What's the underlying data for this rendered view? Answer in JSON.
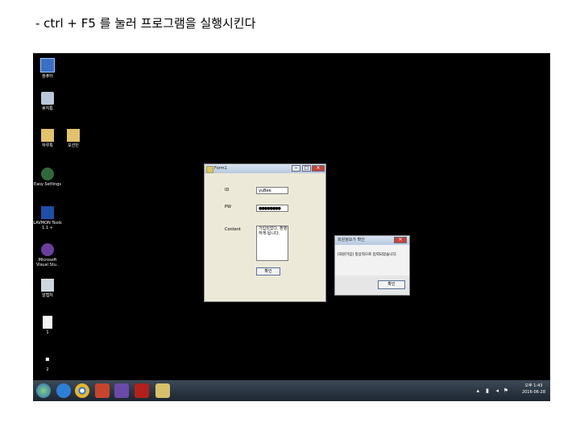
{
  "caption": "- ctrl + F5 를 눌러 프로그램을 실행시킨다",
  "desktop_icons": [
    {
      "label": "컴퓨터",
      "icon": "computer-icon"
    },
    {
      "label": "휴지통",
      "icon": "recycle-bin-icon"
    },
    {
      "label": "하루톡",
      "icon": "folder-icon"
    },
    {
      "label": "모선민",
      "icon": "folder-icon"
    },
    {
      "label": "Easy Settings",
      "icon": "easy-settings-icon"
    },
    {
      "label": "LAVMON Tools 1.1 +",
      "icon": "lavmon-icon"
    },
    {
      "label": "Microsoft Visual Stu..",
      "icon": "visual-studio-icon"
    },
    {
      "label": "알캡처",
      "icon": "alcapture-icon"
    },
    {
      "label": "1",
      "icon": "document-icon"
    },
    {
      "label": "2",
      "icon": "shortcut-icon"
    }
  ],
  "main_window": {
    "title": "Form1",
    "id_label": "ID",
    "id_value": "yuBee",
    "pw_label": "PW",
    "pw_value": "●●●●●●●●",
    "content_label": "Content",
    "content_value": "가입되었다. 환영하게 됩니다.",
    "confirm_button": "확인"
  },
  "message_box": {
    "title": "회원정보가 확인",
    "message": "[회원가입] 정상적으로 입력되었습니다.",
    "ok_button": "확인"
  },
  "taskbar": {
    "items": [
      "start-orb-icon",
      "ie-icon",
      "chrome-icon",
      "powerpoint-icon",
      "visual-studio-icon",
      "acrobat-icon",
      "notepad-icon"
    ],
    "time": "오후 1:43",
    "date": "2016-06-28"
  }
}
